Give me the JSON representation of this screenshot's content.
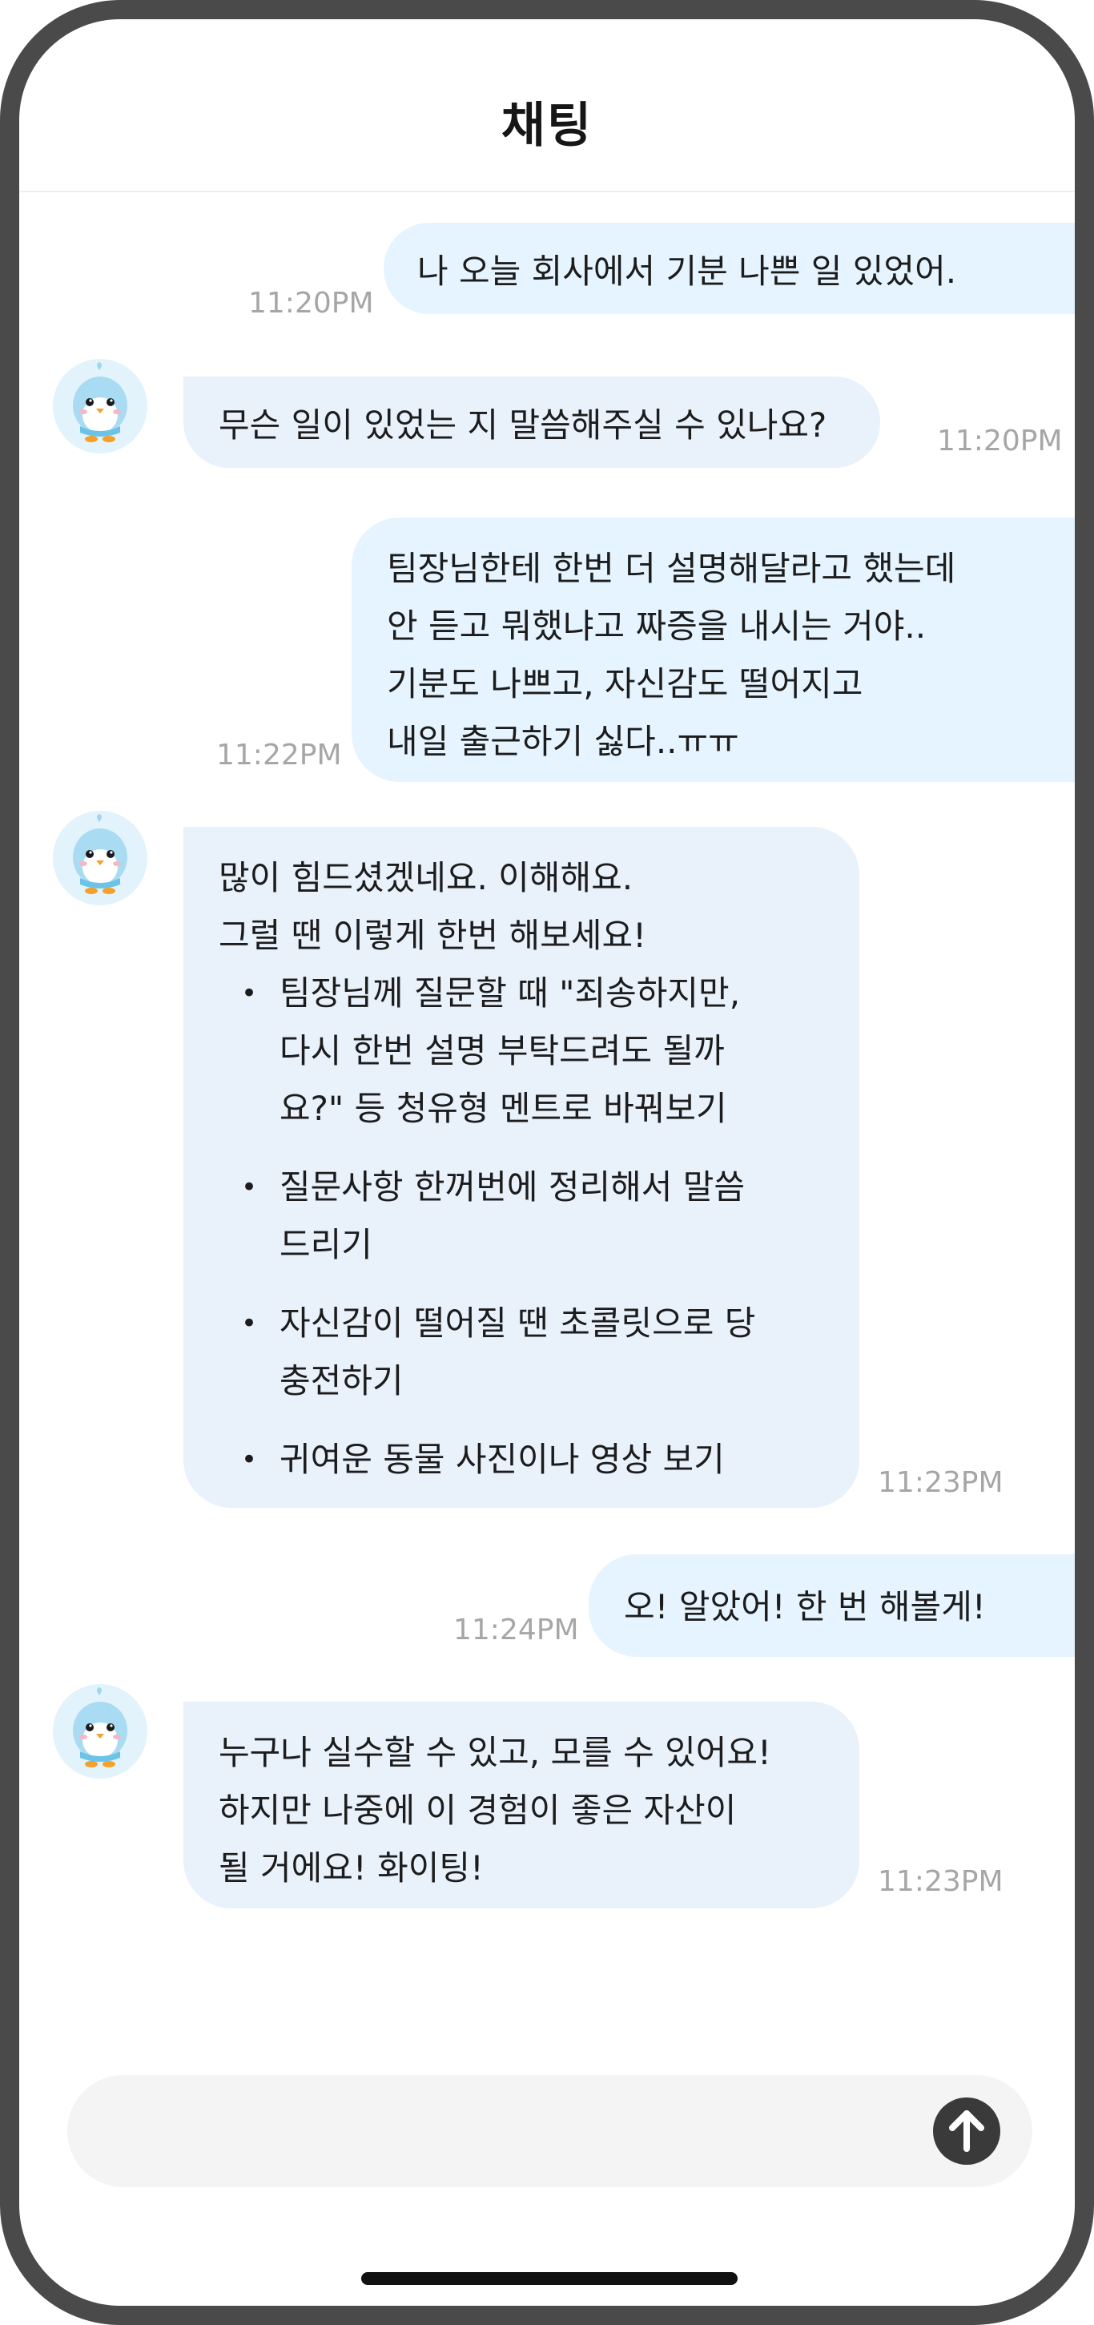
{
  "header": {
    "title": "채팅"
  },
  "messages": [
    {
      "sender": "user",
      "text": "나 오늘 회사에서 기분 나쁜 일 있었어.",
      "time": "11:20PM"
    },
    {
      "sender": "bot",
      "text": "무슨 일이 있었는 지 말씀해주실 수 있나요?",
      "time": "11:20PM"
    },
    {
      "sender": "user",
      "lines": [
        "팀장님한테 한번 더 설명해달라고 했는데",
        "안 듣고 뭐했냐고 짜증을 내시는 거야..",
        "기분도 나쁘고, 자신감도 떨어지고",
        "내일 출근하기 싫다..ㅠㅠ"
      ],
      "time": "11:22PM"
    },
    {
      "sender": "bot",
      "lines": [
        "많이 힘드셨겠네요. 이해해요.",
        "그럴 땐 이렇게 한번 해보세요!"
      ],
      "bullets": [
        [
          "팀장님께 질문할 때 \"죄송하지만,",
          "다시 한번 설명 부탁드려도 될까",
          "요?\" 등 청유형 멘트로 바꿔보기"
        ],
        [
          "질문사항 한꺼번에 정리해서 말씀",
          "드리기"
        ],
        [
          "자신감이 떨어질 땐 초콜릿으로 당",
          "충전하기"
        ],
        [
          "귀여운 동물 사진이나 영상 보기"
        ]
      ],
      "time": "11:23PM"
    },
    {
      "sender": "user",
      "text": "오! 알았어! 한 번 해볼게!",
      "time": "11:24PM"
    },
    {
      "sender": "bot",
      "lines": [
        "누구나 실수할 수 있고, 모를 수 있어요!",
        "하지만 나중에 이 경험이 좋은 자산이",
        "될 거에요! 화이팅!"
      ],
      "time": "11:23PM"
    }
  ],
  "input": {
    "placeholder": "",
    "send_icon": "arrow-up-icon"
  },
  "colors": {
    "frame": "#4a4a4a",
    "user_bubble": "#e5f4fe",
    "bot_bubble": "#e9f1fb",
    "time": "#a6a6a6",
    "send_button": "#3a3a3a"
  }
}
